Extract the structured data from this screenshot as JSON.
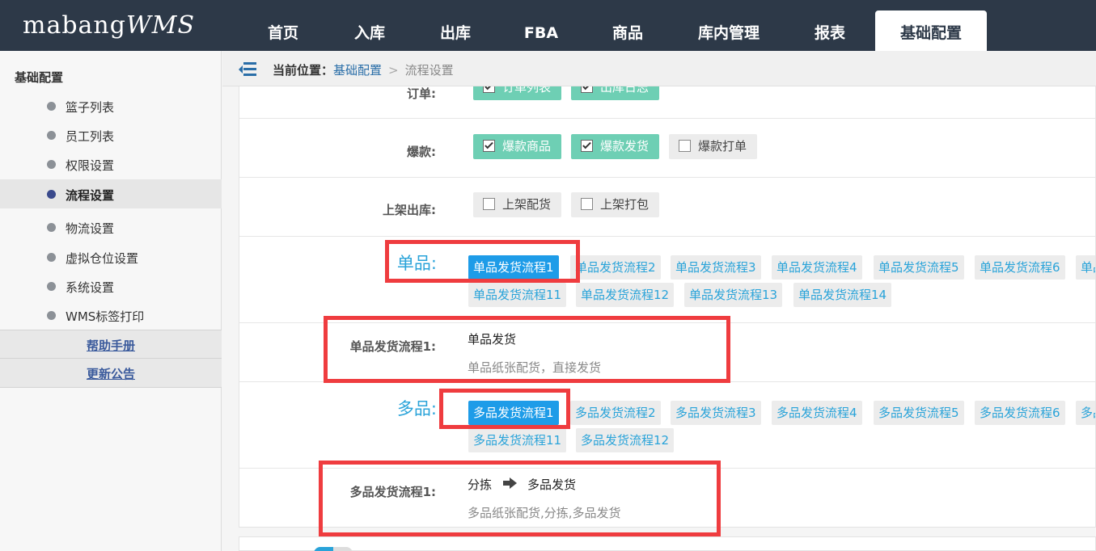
{
  "app": {
    "logo_main": "mabang",
    "logo_suffix": "WMS"
  },
  "nav": {
    "items": [
      "首页",
      "入库",
      "出库",
      "FBA",
      "商品",
      "库内管理",
      "报表",
      "基础配置"
    ],
    "active": "基础配置"
  },
  "sidebar": {
    "title": "基础配置",
    "items": [
      "篮子列表",
      "员工列表",
      "权限设置",
      "流程设置",
      "物流设置",
      "虚拟仓位设置",
      "系统设置",
      "WMS标签打印"
    ],
    "active": "流程设置",
    "links": [
      "帮助手册",
      "更新公告"
    ]
  },
  "breadcrumb": {
    "prefix": "当前位置：",
    "parent": "基础配置",
    "separator": ">",
    "current": "流程设置"
  },
  "rows": {
    "order": {
      "label": "订单:",
      "options": [
        {
          "text": "订单列表",
          "checked": true
        },
        {
          "text": "出库日志",
          "checked": true
        }
      ]
    },
    "hot": {
      "label": "爆款:",
      "options": [
        {
          "text": "爆款商品",
          "checked": true
        },
        {
          "text": "爆款发货",
          "checked": true
        },
        {
          "text": "爆款打单",
          "checked": false
        }
      ]
    },
    "shelf": {
      "label": "上架出库:",
      "options": [
        {
          "text": "上架配货",
          "checked": false
        },
        {
          "text": "上架打包",
          "checked": false
        }
      ]
    }
  },
  "single": {
    "label": "单品:",
    "flows_row1": [
      "单品发货流程1",
      "单品发货流程2",
      "单品发货流程3",
      "单品发货流程4",
      "单品发货流程5",
      "单品发货流程6",
      "单品"
    ],
    "flows_row2": [
      "单品发货流程11",
      "单品发货流程12",
      "单品发货流程13",
      "单品发货流程14"
    ],
    "selected": "单品发货流程1",
    "detail": {
      "label": "单品发货流程1:",
      "step1": "单品发货",
      "desc": "单品纸张配货，直接发货"
    }
  },
  "multi": {
    "label": "多品:",
    "flows_row1": [
      "多品发货流程1",
      "多品发货流程2",
      "多品发货流程3",
      "多品发货流程4",
      "多品发货流程5",
      "多品发货流程6",
      "多品"
    ],
    "flows_row2": [
      "多品发货流程11",
      "多品发货流程12"
    ],
    "selected": "多品发货流程1",
    "detail": {
      "label": "多品发货流程1:",
      "step1": "分拣",
      "step2": "多品发货",
      "desc": "多品纸张配货,分拣,多品发货"
    }
  },
  "colors": {
    "topbar": "#2d3948",
    "checked_bg": "#6ecfb4",
    "selected_flow": "#1e9ce8",
    "link": "#29a3d9",
    "highlight": "#ef3c3f"
  },
  "icons": [
    "menu-toggle-icon",
    "checkbox-icon",
    "arrow-right-icon"
  ]
}
